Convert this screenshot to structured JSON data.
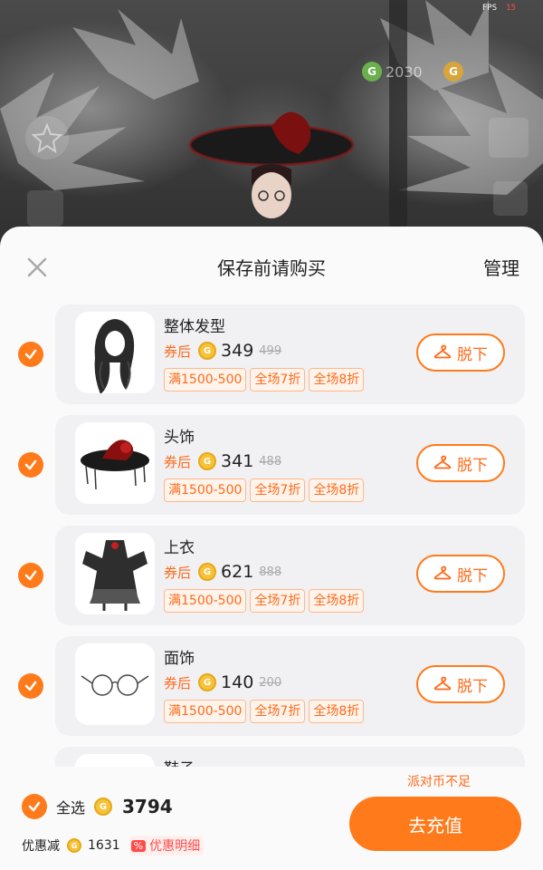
{
  "hud": {
    "fps_label": "FPS",
    "fps_value": "15",
    "green_currency": "2030",
    "gold_currency": ""
  },
  "sheet": {
    "title": "保存前请购买",
    "manage_label": "管理"
  },
  "items": [
    {
      "name": "整体发型",
      "coupon_label": "券后",
      "price": "349",
      "original_price": "499",
      "tags": [
        "满1500-500",
        "全场7折",
        "全场8折"
      ],
      "action_label": "脱下",
      "checked": true,
      "thumb": "hair"
    },
    {
      "name": "头饰",
      "coupon_label": "券后",
      "price": "341",
      "original_price": "488",
      "tags": [
        "满1500-500",
        "全场7折",
        "全场8折"
      ],
      "action_label": "脱下",
      "checked": true,
      "thumb": "hat"
    },
    {
      "name": "上衣",
      "coupon_label": "券后",
      "price": "621",
      "original_price": "888",
      "tags": [
        "满1500-500",
        "全场7折",
        "全场8折"
      ],
      "action_label": "脱下",
      "checked": true,
      "thumb": "dress"
    },
    {
      "name": "面饰",
      "coupon_label": "券后",
      "price": "140",
      "original_price": "200",
      "tags": [
        "满1500-500",
        "全场7折",
        "全场8折"
      ],
      "action_label": "脱下",
      "checked": true,
      "thumb": "glasses"
    },
    {
      "name": "鞋子",
      "coupon_label": "",
      "price": "",
      "original_price": "",
      "tags": [],
      "action_label": "",
      "checked": false,
      "thumb": "shoes"
    }
  ],
  "footer": {
    "insufficient_text": "派对币不足",
    "select_all_label": "全选",
    "total_price": "3794",
    "discount_label": "优惠减",
    "discount_amount": "1631",
    "detail_icon": "%",
    "detail_label": "优惠明细",
    "recharge_label": "去充值"
  },
  "colors": {
    "accent": "#ff7a1a",
    "coin": "#f5c23a",
    "badge_red": "#ff4a4a"
  }
}
